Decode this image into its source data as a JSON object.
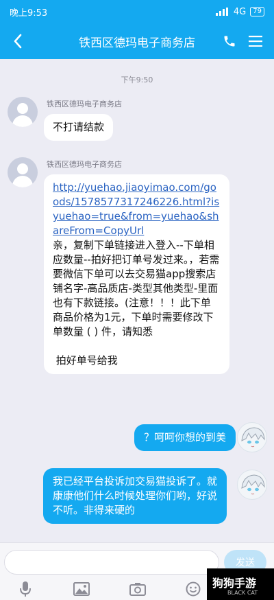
{
  "status": {
    "time": "晚上9:53",
    "signal": "4G",
    "battery": "79"
  },
  "header": {
    "title": "铁西区德玛电子商务店"
  },
  "chat": {
    "timestamp": "下午9:50",
    "messages": [
      {
        "sender": "铁西区德玛电子商务店",
        "text": "不打请结款"
      },
      {
        "sender": "铁西区德玛电子商务店",
        "link": "http://yuehao.jiaoyimao.com/goods/1578577317246226.html?isyuehao=true&from=yuehao&shareFrom=CopyUrl",
        "text": "亲，复制下单链接进入登入--下单相应数量--拍好把订单号发过来。，若需要微信下单可以去交易猫app搜索店铺名字-高品质店-类型其他类型-里面也有下款链接。(注意！！！此下单商品价格为1元，下单时需要修改下单数量 ( ) 件，请知悉\n\n 拍好单号给我"
      },
      {
        "text": "？呵呵你想的到美"
      },
      {
        "text": "我已经平台投诉加交易猫投诉了。就康康他们什么时候处理你们哟，好说不听。非得来硬的"
      }
    ]
  },
  "input": {
    "placeholder": "",
    "value": "",
    "send_label": "发送"
  },
  "watermark": {
    "title": "狗狗手游",
    "subtitle": "BLACK CAT"
  },
  "colors": {
    "accent": "#14a9f0",
    "background": "#ececf4",
    "link": "#2a63c2"
  }
}
